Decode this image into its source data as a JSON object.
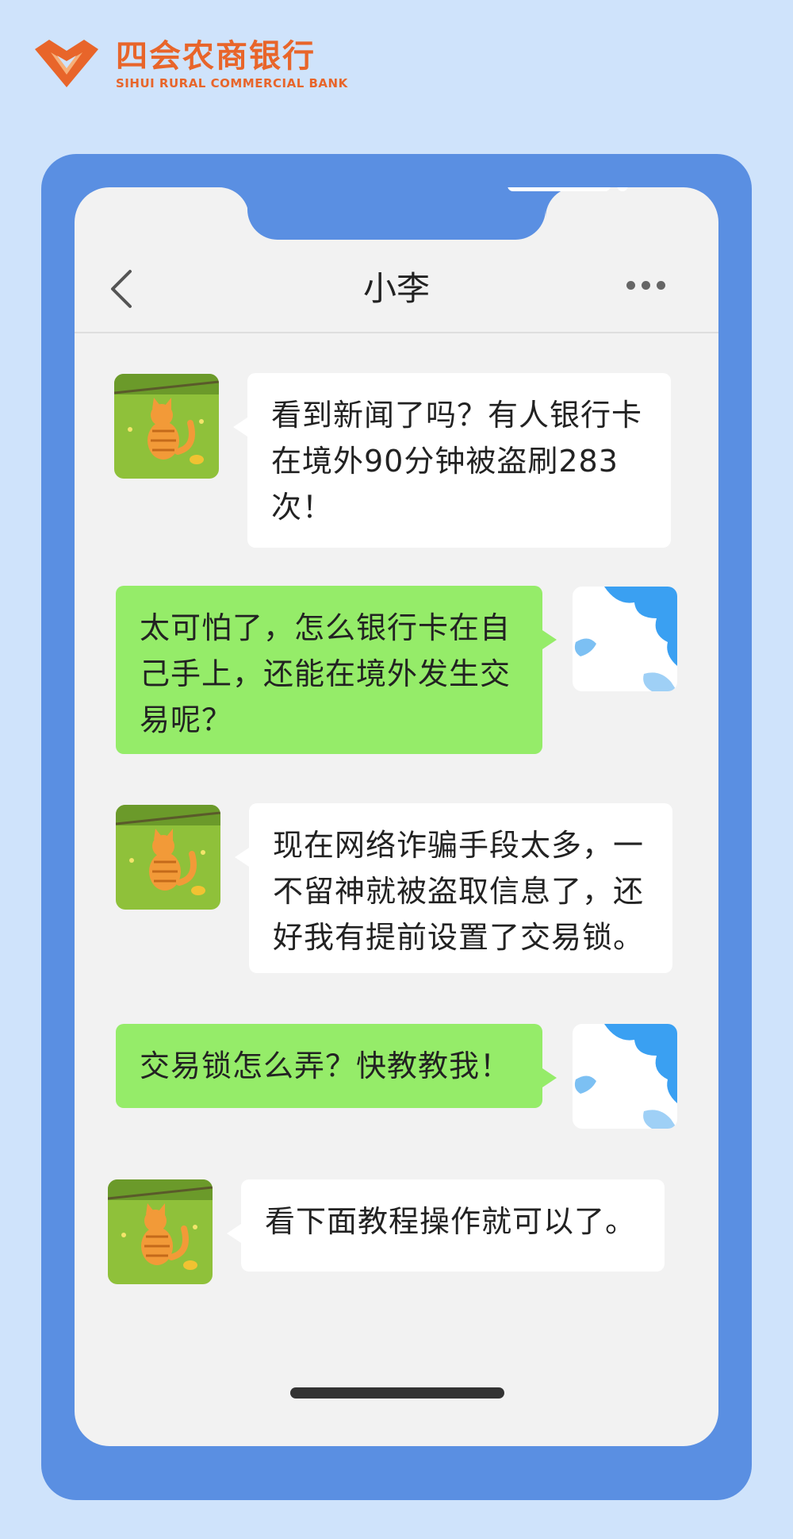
{
  "bank": {
    "name_cn": "四会农商银行",
    "name_en": "SIHUI RURAL COMMERCIAL BANK",
    "brand_color": "#e8652a"
  },
  "colors": {
    "frame": "#5a8fe2",
    "background": "#cfe3fb",
    "incoming_bubble": "#ffffff",
    "outgoing_bubble": "#95ec69"
  },
  "header": {
    "title": "小李",
    "back_icon": "chevron-left-icon",
    "more_icon": "more-horizontal-icon"
  },
  "messages": [
    {
      "sender": "contact",
      "avatar": "cat-avatar",
      "text": "看到新闻了吗？有人银行卡在境外90分钟被盗刷283次！"
    },
    {
      "sender": "self",
      "avatar": "cloud-avatar",
      "text": "太可怕了，怎么银行卡在自己手上，还能在境外发生交易呢？"
    },
    {
      "sender": "contact",
      "avatar": "cat-avatar",
      "text": "现在网络诈骗手段太多，一不留神就被盗取信息了，还好我有提前设置了交易锁。"
    },
    {
      "sender": "self",
      "avatar": "cloud-avatar",
      "text": "交易锁怎么弄？快教教我！"
    },
    {
      "sender": "contact",
      "avatar": "cat-avatar",
      "text": "看下面教程操作就可以了。"
    }
  ]
}
